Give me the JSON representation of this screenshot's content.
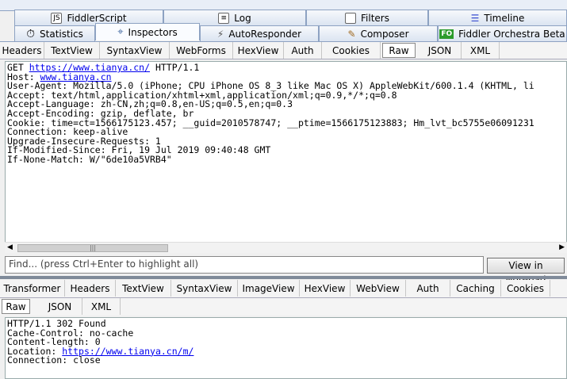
{
  "top_tabs_row1": [
    {
      "label": "FiddlerScript",
      "icon": "js-icon"
    },
    {
      "label": "Log",
      "icon": "log-icon"
    },
    {
      "label": "Filters",
      "icon": "checkbox-icon"
    },
    {
      "label": "Timeline",
      "icon": "timeline-icon"
    }
  ],
  "top_tabs_row2": [
    {
      "label": "Statistics",
      "icon": "stopwatch-icon"
    },
    {
      "label": "Inspectors",
      "icon": "inspect-icon"
    },
    {
      "label": "AutoResponder",
      "icon": "lightning-icon"
    },
    {
      "label": "Composer",
      "icon": "pencil-icon"
    },
    {
      "label": "Fiddler Orchestra Beta",
      "icon": "fo-icon",
      "icon_text": "FO"
    }
  ],
  "request_tabs": [
    "Headers",
    "TextView",
    "SyntaxView",
    "WebForms",
    "HexView",
    "Auth",
    "Cookies",
    "Raw",
    "JSON",
    "XML"
  ],
  "request_raw": {
    "line1_pre": "GET ",
    "line1_link": "https://www.tianya.cn/",
    "line1_post": " HTTP/1.1",
    "host_pre": "Host: ",
    "host_link": "www.tianya.cn",
    "headers": [
      "User-Agent: Mozilla/5.0 (iPhone; CPU iPhone OS 8_3 like Mac OS X) AppleWebKit/600.1.4 (KHTML, li",
      "Accept: text/html,application/xhtml+xml,application/xml;q=0.9,*/*;q=0.8",
      "Accept-Language: zh-CN,zh;q=0.8,en-US;q=0.5,en;q=0.3",
      "Accept-Encoding: gzip, deflate, br",
      "Cookie: time=ct=1566175123.457; __guid=2010578747; __ptime=1566175123883; Hm_lvt_bc5755e06091231",
      "Connection: keep-alive",
      "Upgrade-Insecure-Requests: 1",
      "If-Modified-Since: Fri, 19 Jul 2019 09:40:48 GMT",
      "If-None-Match: W/\"6de10a5VRB4\""
    ]
  },
  "find": {
    "placeholder": "Find... (press Ctrl+Enter to highlight all)",
    "button": "View in Notepad"
  },
  "response_tabs_row1": [
    "Transformer",
    "Headers",
    "TextView",
    "SyntaxView",
    "ImageView",
    "HexView",
    "WebView",
    "Auth",
    "Caching",
    "Cookies"
  ],
  "response_tabs_row2": [
    "Raw",
    "JSON",
    "XML"
  ],
  "response_raw": {
    "lines": [
      "HTTP/1.1 302 Found",
      "Cache-Control: no-cache",
      "Content-length: 0"
    ],
    "location_pre": "Location: ",
    "location_link": "https://www.tianya.cn/m/",
    "last": "Connection: close"
  }
}
